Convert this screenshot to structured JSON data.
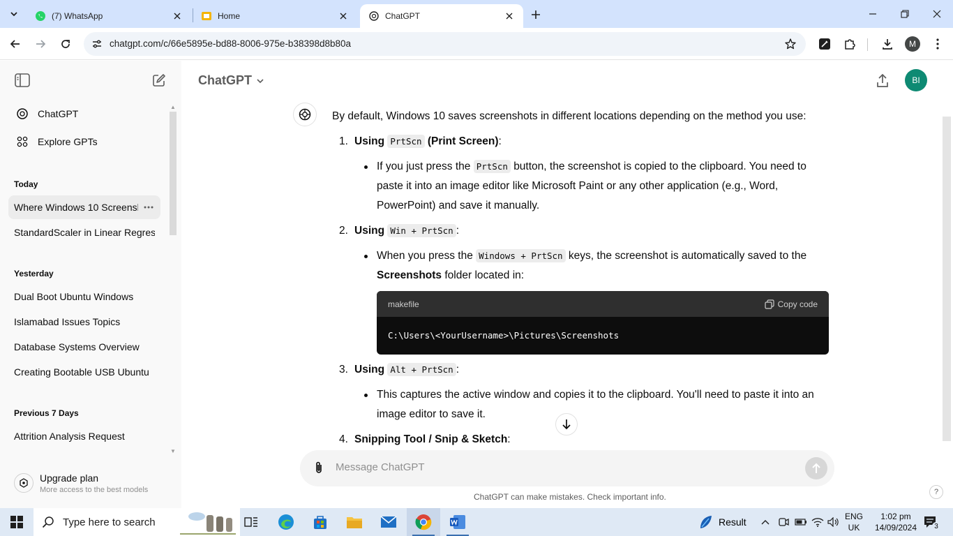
{
  "browser": {
    "tabs": [
      {
        "label": "(7) WhatsApp"
      },
      {
        "label": "Home"
      },
      {
        "label": "ChatGPT"
      }
    ],
    "url": "chatgpt.com/c/66e5895e-bd88-8006-975e-b38398d8b80a",
    "profile_initial": "M"
  },
  "sidebar": {
    "nav": [
      {
        "label": "ChatGPT"
      },
      {
        "label": "Explore GPTs"
      }
    ],
    "groups": [
      {
        "label": "Today",
        "items": [
          "Where Windows 10 Screensh",
          "StandardScaler in Linear Regress"
        ]
      },
      {
        "label": "Yesterday",
        "items": [
          "Dual Boot Ubuntu Windows",
          "Islamabad Issues Topics",
          "Database Systems Overview",
          "Creating Bootable USB Ubuntu"
        ]
      },
      {
        "label": "Previous 7 Days",
        "items": [
          "Attrition Analysis Request"
        ]
      }
    ],
    "upgrade": {
      "title": "Upgrade plan",
      "subtitle": "More access to the best models"
    }
  },
  "header": {
    "model": "ChatGPT",
    "avatar_initials": "BI"
  },
  "message": {
    "intro": "By default, Windows 10 saves screenshots in different locations depending on the method you use:",
    "steps": [
      {
        "num": "1.",
        "prefix": "Using",
        "code": "PrtScn",
        "suffix": "(Print Screen)",
        "colon": ":",
        "bullet_pre": "If you just press the",
        "bullet_code": "PrtScn",
        "bullet_post": "button, the screenshot is copied to the clipboard. You need to paste it into an image editor like Microsoft Paint or any other application (e.g., Word, PowerPoint) and save it manually."
      },
      {
        "num": "2.",
        "prefix": "Using",
        "code": "Win + PrtScn",
        "colon": ":",
        "bullet_pre": "When you press the",
        "bullet_code": "Windows + PrtScn",
        "bullet_mid": "keys, the screenshot is automatically saved to the",
        "bullet_bold": "Screenshots",
        "bullet_post": "folder located in:",
        "codeblock": {
          "language": "makefile",
          "copy_label": "Copy code",
          "content": "C:\\Users\\<YourUsername>\\Pictures\\Screenshots"
        }
      },
      {
        "num": "3.",
        "prefix": "Using",
        "code": "Alt + PrtScn",
        "colon": ":",
        "bullet_pre": "This captures the active window and copies it to the clipboard. You'll need to paste it into an image editor to save it."
      },
      {
        "num": "4.",
        "title": "Snipping Tool / Snip & Sketch",
        "colon": ":"
      }
    ]
  },
  "composer": {
    "placeholder": "Message ChatGPT",
    "disclaimer": "ChatGPT can make mistakes. Check important info.",
    "help": "?"
  },
  "taskbar": {
    "search_placeholder": "Type here to search",
    "weather_label": "Result",
    "language": [
      "ENG",
      "UK"
    ],
    "time": "1:02 pm",
    "date": "14/09/2024",
    "notification_count": "3"
  }
}
